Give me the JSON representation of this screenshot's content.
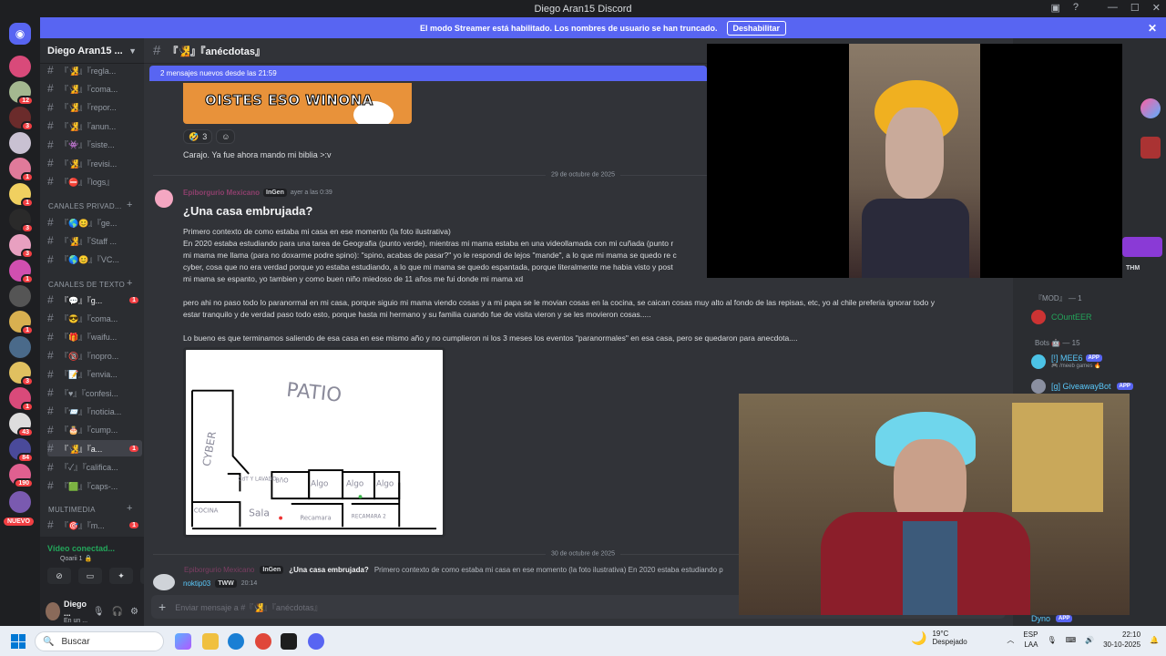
{
  "window": {
    "title": "Diego Aran15 Discord"
  },
  "streamer_banner": {
    "message": "El modo Streamer está habilitado. Los nombres de usuario se han truncado.",
    "button": "Deshabilitar"
  },
  "server": {
    "name": "Diego Aran15 ..."
  },
  "channels": {
    "top": [
      {
        "label": "『🧏』『regla...",
        "unread": false
      },
      {
        "label": "『🧏』『coma...",
        "unread": false
      },
      {
        "label": "『🧏』『repor...",
        "unread": false
      },
      {
        "label": "『🧏』『anun...",
        "unread": false
      },
      {
        "label": "『👾』『siste...",
        "unread": false
      },
      {
        "label": "『🧏』『revisi...",
        "unread": false
      },
      {
        "label": "『⛔』『logs』",
        "unread": false
      }
    ],
    "private_category": "CANALES PRIVAD...",
    "private": [
      {
        "label": "『🌎😊』『ge...",
        "unread": false
      },
      {
        "label": "『🧏』『Staff ...",
        "unread": false
      },
      {
        "label": "『🌎😊』『VC...",
        "unread": false
      }
    ],
    "text_category": "CANALES DE TEXTO",
    "text": [
      {
        "label": "『💬』『g...",
        "unread": true,
        "badge": "1"
      },
      {
        "label": "『😎』『coma...",
        "unread": false
      },
      {
        "label": "『🎁』『waifu...",
        "unread": false
      },
      {
        "label": "『🔞』『nopro...",
        "unread": false
      },
      {
        "label": "『📝』『envia...",
        "unread": false
      },
      {
        "label": "『♥』『confesi...",
        "unread": false
      },
      {
        "label": "『📨』『noticia...",
        "unread": false
      },
      {
        "label": "『🎂』『cump...",
        "unread": false
      },
      {
        "label": "『🧏』『a...",
        "unread": true,
        "badge": "1",
        "selected": true
      },
      {
        "label": "『✓』『califica...",
        "unread": false
      },
      {
        "label": "『🟩』『caps-...",
        "unread": false
      }
    ],
    "media_category": "MULTIMEDIA",
    "media": [
      {
        "label": "『🎯』『m...",
        "unread": false,
        "badge": "1"
      }
    ]
  },
  "guild_badges": [
    "12",
    "3",
    "1",
    "1",
    "3",
    "3",
    "1",
    "1",
    "3",
    "1",
    "43",
    "84",
    "190"
  ],
  "guild_new": "NUEVO",
  "voice": {
    "status": "Vídeo conectad...",
    "server": "Qoarii 1 🔒"
  },
  "user": {
    "name": "Diego ...",
    "status": "En un ..."
  },
  "chat": {
    "channel_name": "『🧏』『anécdotas』",
    "new_messages": "2 mensajes nuevos desde las 21:59",
    "meme_text": "OISTES ESO WINONA",
    "reaction_count": "3",
    "message_1": "Carajo.  Ya fue ahora mando mi biblia >:v",
    "date_1": "29 de octubre de 2025",
    "post": {
      "author": "Epiborgurio Mexicano",
      "tag": "InGen",
      "time": "ayer a las 0:39",
      "title": "¿Una casa embrujada?",
      "paragraphs": [
        "Primero contexto de como estaba mi casa en ese momento (la foto ilustrativa)",
        "En 2020 estaba estudiando para una tarea de Geografia (punto verde), mientras mi mama estaba en una videollamada con mi cuñada (punto r",
        "mi mama me llama (para no doxarme podre spino): \"spino, acabas de pasar?\" yo le respondi de lejos \"mande\", a lo que mi mama se quedo re c",
        "cyber, cosa que no era verdad porque yo estaba estudiando, a lo que mi mama se quedo espantada, porque literalmente me habia visto y post",
        "mi mama se espanto, yo tambien y como buen niño miedoso de 11 años me fui donde mi mama xd",
        "pero ahi no paso todo lo paranormal en mi casa, porque siguio mi mama viendo cosas y a mi papa se le movian cosas en la cocina, se caican cosas muy alto al fondo de las repisas, etc, yo al chile preferia ignorar todo y",
        "estar tranquilo y de verdad paso todo esto, porque hasta mi hermano y su familia cuando fue de visita vieron y se les movieron cosas.....",
        "Lo bueno es que terminamos saliendo de esa casa en ese mismo año y no cumplieron ni los 3 meses los eventos \"paranormales\" en esa casa, pero se quedaron para anecdota...."
      ]
    },
    "drawing_labels": {
      "patio": "PATIO",
      "cyber": "CYBER",
      "cuarto": "CdT Y LAVADO",
      "bano": "BñO",
      "algo1": "Algo",
      "algo2": "Algo",
      "algo3": "Algo",
      "cocina": "COCINA",
      "sala": "Sala",
      "recamara1": "Recamara",
      "recamara2": "RECAMARA 2"
    },
    "date_2": "30 de octubre de 2025",
    "reply": {
      "author": "Epiborgurio Mexicano",
      "tag": "InGen",
      "title": "¿Una casa embrujada?",
      "snippet": "Primero contexto de como estaba mi casa en ese momento (la foto ilustrativa) En 2020 estaba estudiando p"
    },
    "message_2": {
      "author": "noktip03",
      "tag": "TWW",
      "time": "20:14"
    },
    "composer_placeholder": "Enviar mensaje a #『🧏』『anécdotas』"
  },
  "members": {
    "overlay_tag": "THM",
    "mod_category": "『MOD』 — 1",
    "mod_members": [
      {
        "name": "COuntEER",
        "color": "#23a55a"
      }
    ],
    "bots_category": "Bots 🤖 — 15",
    "bots": [
      {
        "name": "[!] MEE6",
        "sub": "🎮 /meeb games 🔥"
      },
      {
        "name": "[g] GiveawayBot",
        "sub": ""
      }
    ],
    "bottom_bot": "Dyno",
    "app_label": "APP"
  },
  "taskbar": {
    "search_placeholder": "Buscar",
    "weather_temp": "19°C",
    "weather_desc": "Despejado",
    "lang_1": "ESP",
    "lang_2": "LAA",
    "time": "22:10",
    "date": "30-10-2025"
  },
  "colors": {
    "accent": "#5865f2",
    "danger": "#f23f43",
    "bg": "#313338",
    "sidebar": "#2b2d31"
  }
}
